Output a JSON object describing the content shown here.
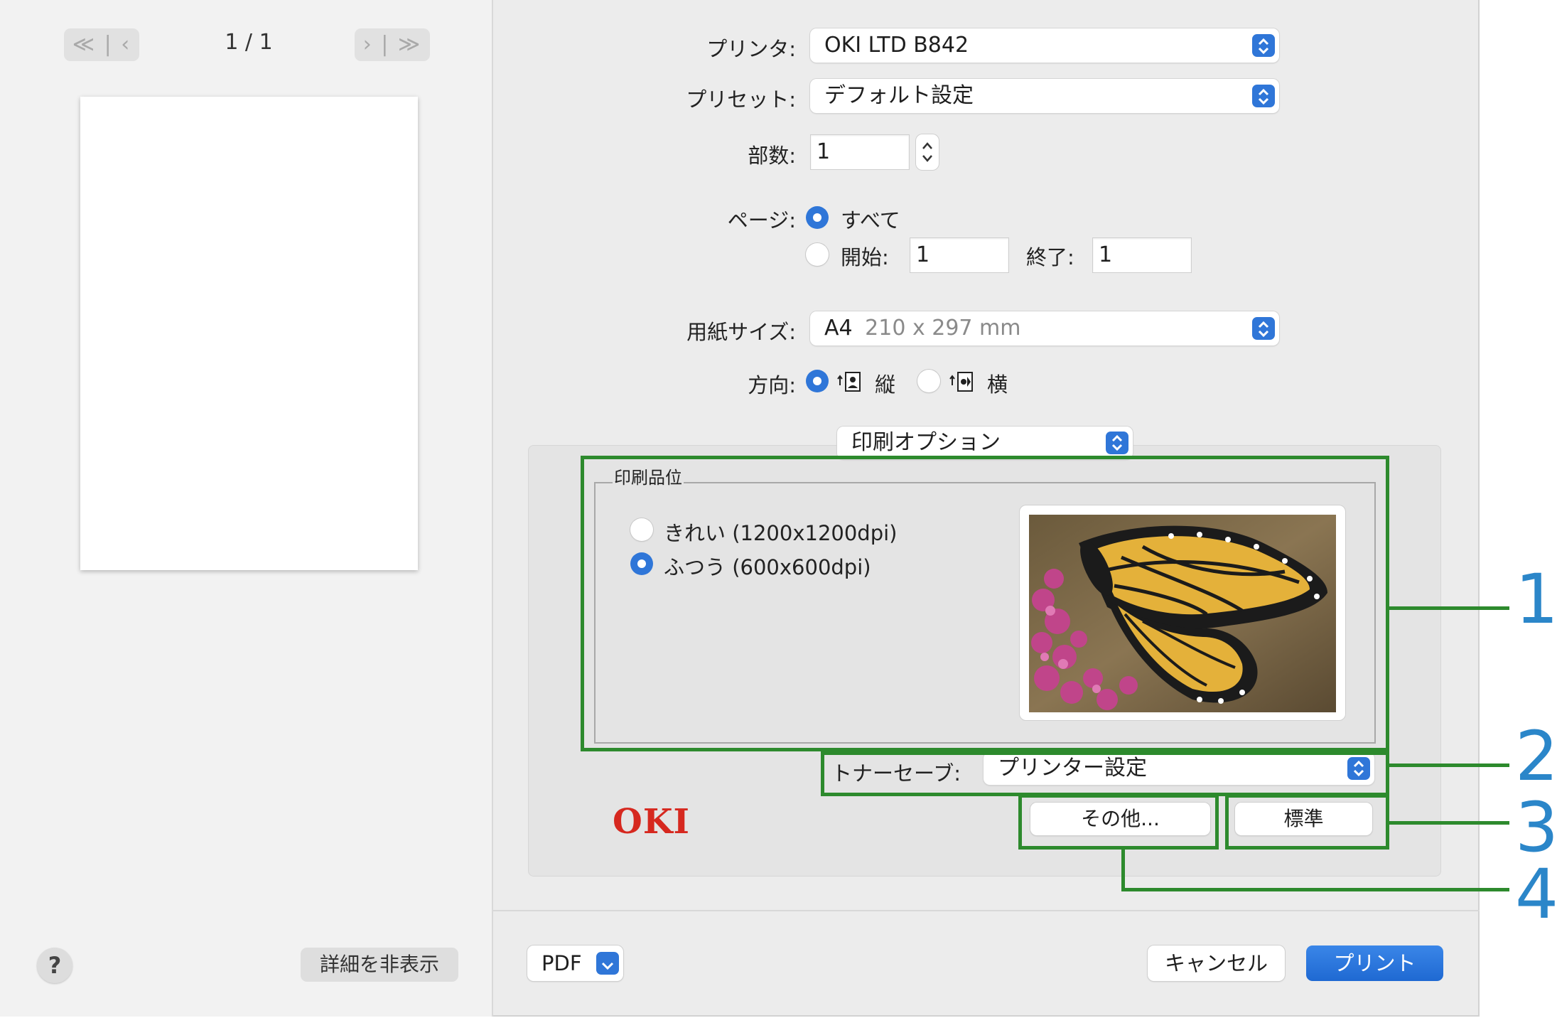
{
  "preview": {
    "first_prev_label": "≪ | ‹",
    "next_last_label": "› | ≫",
    "page_counter": "1 / 1",
    "help_label": "?",
    "hide_details_label": "詳細を非表示"
  },
  "form": {
    "printer_label": "プリンタ:",
    "printer_value": "OKI LTD B842",
    "preset_label": "プリセット:",
    "preset_value": "デフォルト設定",
    "copies_label": "部数:",
    "copies_value": "1",
    "pages_label": "ページ:",
    "pages_all_label": "すべて",
    "pages_from_label": "開始:",
    "pages_from_value": "1",
    "pages_to_label": "終了:",
    "pages_to_value": "1",
    "paper_size_label": "用紙サイズ:",
    "paper_size_name": "A4",
    "paper_size_dims": "210 x 297 mm",
    "orientation_label": "方向:",
    "orientation_portrait_label": "縦",
    "orientation_landscape_label": "横",
    "section_value": "印刷オプション"
  },
  "options": {
    "group_title": "印刷品位",
    "quality_fine_label": "きれい (1200x1200dpi)",
    "quality_normal_label": "ふつう (600x600dpi)",
    "toner_save_label": "トナーセーブ:",
    "toner_save_value": "プリンター設定",
    "other_button_label": "その他...",
    "default_button_label": "標準",
    "logo_text": "OKI"
  },
  "footer": {
    "pdf_label": "PDF",
    "cancel_label": "キャンセル",
    "print_label": "プリント"
  },
  "callouts": [
    "1",
    "2",
    "3",
    "4"
  ],
  "colors": {
    "accent": "#2f76d8",
    "callout_green": "#2d8a2d",
    "callout_number": "#2b86c9",
    "oki_red": "#d6281f"
  }
}
